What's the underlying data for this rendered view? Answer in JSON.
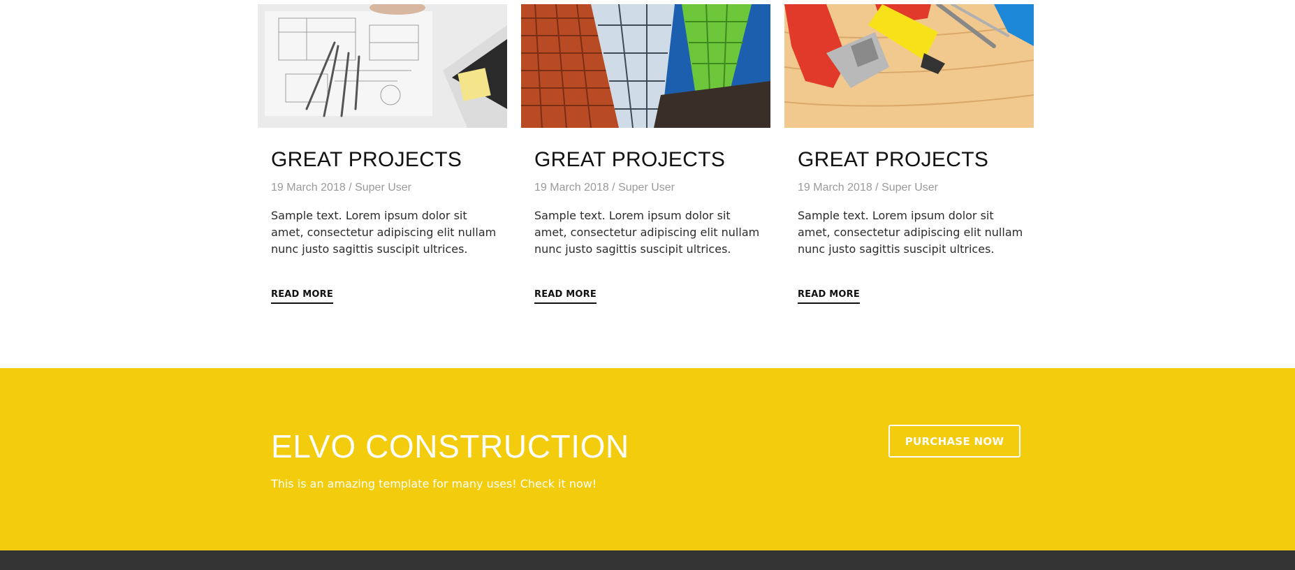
{
  "blog": {
    "posts": [
      {
        "title": "GREAT PROJECTS",
        "meta": "19 March 2018 / Super User",
        "excerpt": "Sample text. Lorem ipsum dolor sit amet, consectetur adipiscing elit nullam nunc justo sagittis suscipit ultrices.",
        "read_more": "READ MORE",
        "image": "architect-drawings-laptop-photo"
      },
      {
        "title": "GREAT PROJECTS",
        "meta": "19 March 2018 / Super User",
        "excerpt": "Sample text. Lorem ipsum dolor sit amet, consectetur adipiscing elit nullam nunc justo sagittis suscipit ultrices.",
        "read_more": "READ MORE",
        "image": "colorful-building-facade-photo"
      },
      {
        "title": "GREAT PROJECTS",
        "meta": "19 March 2018 / Super User",
        "excerpt": "Sample text. Lorem ipsum dolor sit amet, consectetur adipiscing elit nullam nunc justo sagittis suscipit ultrices.",
        "read_more": "READ MORE",
        "image": "tools-on-wood-photo"
      }
    ]
  },
  "cta": {
    "title": "ELVO CONSTRUCTION",
    "subtitle": "This is an amazing template for many uses! Check it now!",
    "button_label": "PURCHASE NOW",
    "background_color": "#f3cc0d"
  },
  "footer": {
    "background_color": "#333333"
  }
}
